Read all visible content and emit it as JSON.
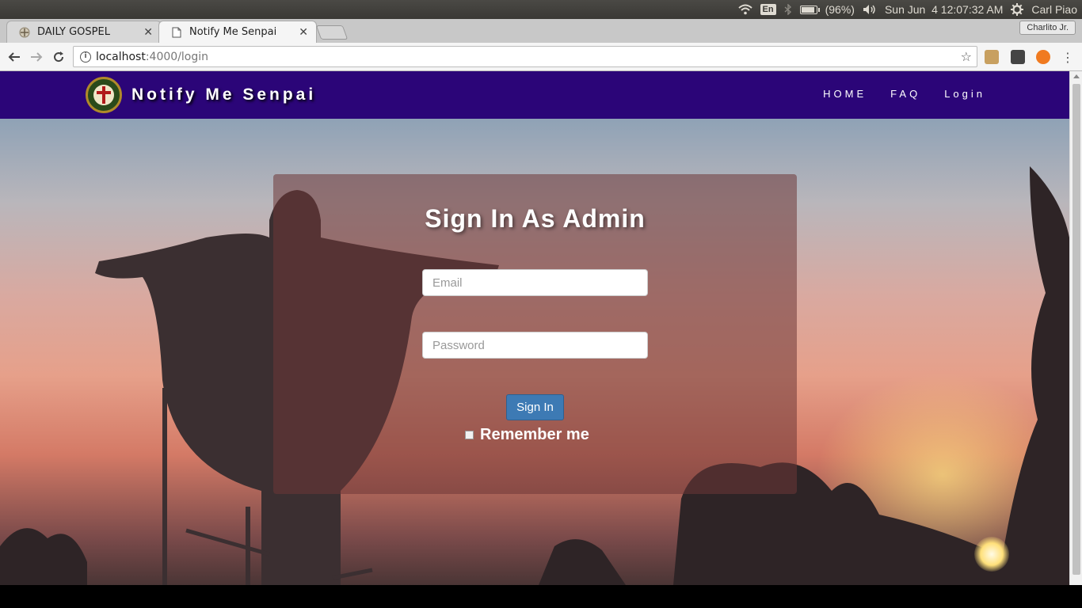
{
  "system_panel": {
    "keyboard_layout": "En",
    "battery": "(96%)",
    "battery_level": 0.96,
    "datetime": "Sun Jun  4 12:07:32 AM",
    "user": "Carl Piao"
  },
  "browser": {
    "tabs": [
      {
        "title": "DAILY GOSPEL",
        "active": false
      },
      {
        "title": "Notify Me Senpai",
        "active": true
      }
    ],
    "profile_name": "Charlito Jr.",
    "url_host": "localhost",
    "url_path": ":4000/login"
  },
  "site": {
    "brand": "Notify Me Senpai",
    "nav": [
      "HOME",
      "FAQ",
      "Login"
    ]
  },
  "login": {
    "title": "Sign In As Admin",
    "email_placeholder": "Email",
    "password_placeholder": "Password",
    "submit_label": "Sign In",
    "remember_label": "Remember me"
  },
  "colors": {
    "navbar": "#2b0578",
    "button": "#3d7ab4"
  }
}
